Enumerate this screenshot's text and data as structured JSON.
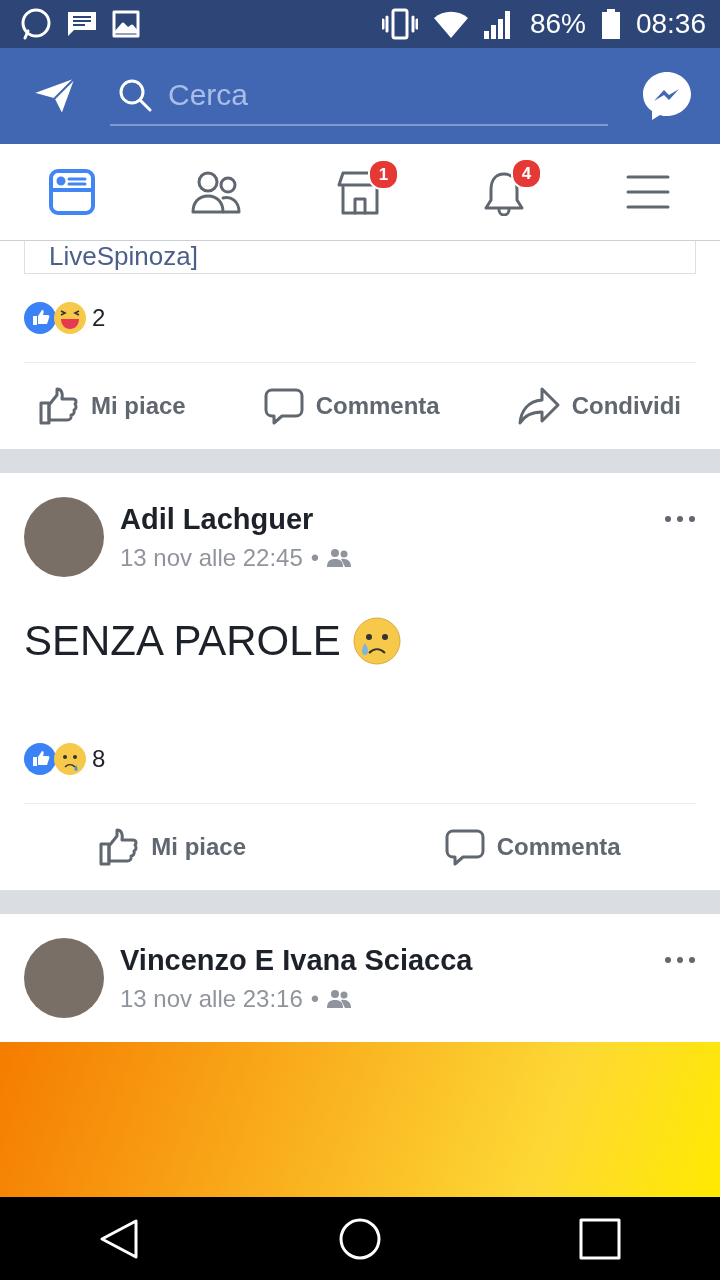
{
  "status_bar": {
    "battery": "86%",
    "time": "08:36"
  },
  "search": {
    "placeholder": "Cerca"
  },
  "tabs": [
    {
      "kind": "feed",
      "selected": true
    },
    {
      "kind": "friends",
      "selected": false
    },
    {
      "kind": "shop",
      "selected": false,
      "badge": "1"
    },
    {
      "kind": "bell",
      "selected": false,
      "badge": "4"
    },
    {
      "kind": "menu",
      "selected": false
    }
  ],
  "top_fragment": {
    "text": "LiveSpinoza]",
    "reactions": [
      {
        "kind": "like"
      },
      {
        "kind": "haha"
      }
    ],
    "count": "2",
    "actions": [
      {
        "kind": "like",
        "label": "Mi piace"
      },
      {
        "kind": "comment",
        "label": "Commenta"
      },
      {
        "kind": "share",
        "label": "Condividi"
      }
    ]
  },
  "posts": [
    {
      "author": "Adil Lachguer",
      "time": "13 nov alle 22:45",
      "dot": "•",
      "text": "SENZA PAROLE",
      "reactions": [
        {
          "kind": "like"
        },
        {
          "kind": "sad"
        }
      ],
      "count": "8",
      "actions": [
        {
          "kind": "like",
          "label": "Mi piace"
        },
        {
          "kind": "comment",
          "label": "Commenta"
        }
      ]
    },
    {
      "author": "Vincenzo E Ivana Sciacca",
      "time": "13 nov alle 23:16",
      "dot": "•"
    }
  ]
}
